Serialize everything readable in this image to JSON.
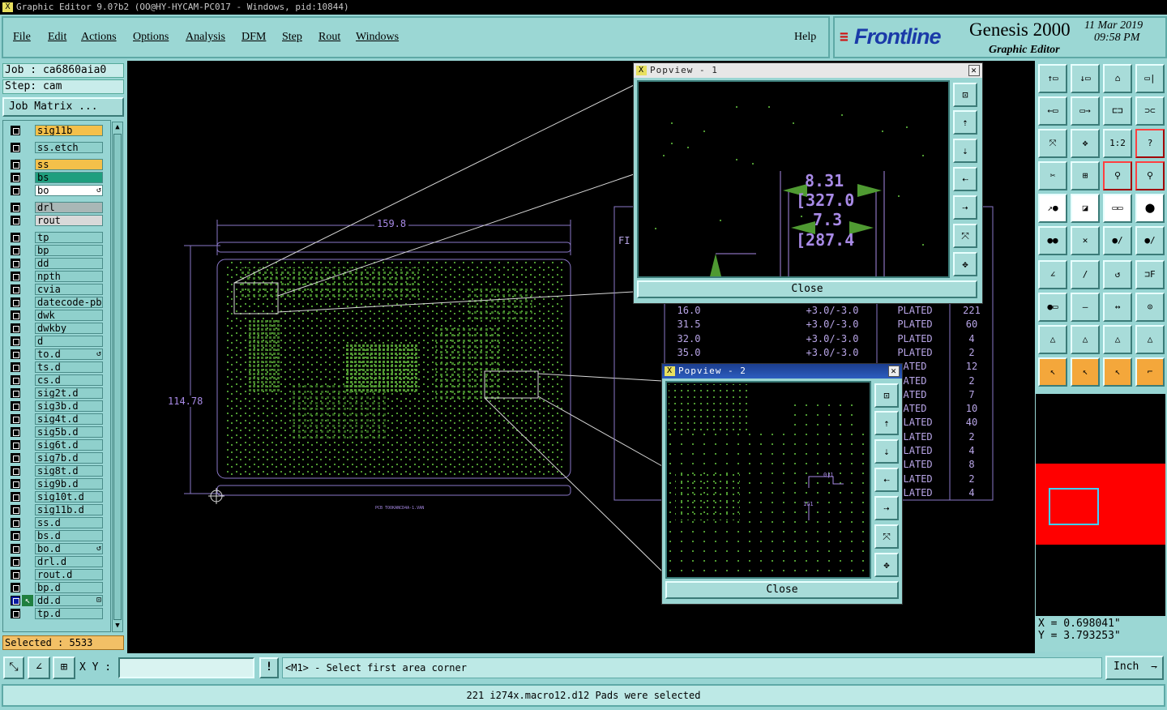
{
  "window": {
    "title": "Graphic Editor 9.0?b2 (OO@HY-HYCAM-PC017 - Windows, pid:10844)",
    "title_icon": "x-icon"
  },
  "menu": {
    "file": "File",
    "edit": "Edit",
    "actions": "Actions",
    "options": "Options",
    "analysis": "Analysis",
    "dfm": "DFM",
    "step": "Step",
    "rout": "Rout",
    "windows": "Windows",
    "help": "Help"
  },
  "brand": {
    "logo": "Frontline",
    "product": "Genesis 2000",
    "subtitle": "Graphic Editor",
    "date": "11 Mar 2019",
    "time": "09:58 PM"
  },
  "job": {
    "job_label": "Job : ca6860aia0",
    "step_label": "Step: cam",
    "matrix_button": "Job Matrix ..."
  },
  "layers": [
    {
      "name": "sig11b",
      "color": "#f4c04a"
    },
    {
      "name": "ss.etch",
      "color": "#8fd0cc"
    },
    {
      "name": "ss",
      "color": "#f4c04a"
    },
    {
      "name": "bs",
      "color": "#1f9e7e"
    },
    {
      "name": "bo",
      "color": "#ffffff",
      "marker": "↺"
    },
    {
      "name": "drl",
      "color": "#a9b7b6"
    },
    {
      "name": "rout",
      "color": "#d9d9d9"
    },
    {
      "name": "tp",
      "color": "#8fd0cc"
    },
    {
      "name": "bp",
      "color": "#8fd0cc"
    },
    {
      "name": "dd",
      "color": "#8fd0cc"
    },
    {
      "name": "npth",
      "color": "#8fd0cc"
    },
    {
      "name": "cvia",
      "color": "#8fd0cc"
    },
    {
      "name": "datecode-pbe",
      "color": "#8fd0cc"
    },
    {
      "name": "dwk",
      "color": "#8fd0cc"
    },
    {
      "name": "dwkby",
      "color": "#8fd0cc"
    },
    {
      "name": "d",
      "color": "#8fd0cc"
    },
    {
      "name": "to.d",
      "color": "#8fd0cc",
      "marker": "↺"
    },
    {
      "name": "ts.d",
      "color": "#8fd0cc"
    },
    {
      "name": "cs.d",
      "color": "#8fd0cc"
    },
    {
      "name": "sig2t.d",
      "color": "#8fd0cc"
    },
    {
      "name": "sig3b.d",
      "color": "#8fd0cc"
    },
    {
      "name": "sig4t.d",
      "color": "#8fd0cc"
    },
    {
      "name": "sig5b.d",
      "color": "#8fd0cc"
    },
    {
      "name": "sig6t.d",
      "color": "#8fd0cc"
    },
    {
      "name": "sig7b.d",
      "color": "#8fd0cc"
    },
    {
      "name": "sig8t.d",
      "color": "#8fd0cc"
    },
    {
      "name": "sig9b.d",
      "color": "#8fd0cc"
    },
    {
      "name": "sig10t.d",
      "color": "#8fd0cc"
    },
    {
      "name": "sig11b.d",
      "color": "#8fd0cc"
    },
    {
      "name": "ss.d",
      "color": "#8fd0cc"
    },
    {
      "name": "bs.d",
      "color": "#8fd0cc"
    },
    {
      "name": "bo.d",
      "color": "#8fd0cc",
      "marker": "↺"
    },
    {
      "name": "drl.d",
      "color": "#8fd0cc"
    },
    {
      "name": "rout.d",
      "color": "#8fd0cc"
    },
    {
      "name": "bp.d",
      "color": "#8fd0cc"
    },
    {
      "name": "dd.d",
      "color": "#8fd0cc",
      "marker": "⊡"
    },
    {
      "name": "tp.d",
      "color": "#8fd0cc"
    }
  ],
  "selected": "Selected : 5533",
  "canvas": {
    "dim_width": "159.8",
    "dim_height": "114.78",
    "tiny_label": "PCB TOOKANCD4A-1.VAN",
    "drill_table": [
      {
        "size": "16.0",
        "tol": "+3.0/-3.0",
        "type": "PLATED",
        "count": "221"
      },
      {
        "size": "31.5",
        "tol": "+3.0/-3.0",
        "type": "PLATED",
        "count": "60"
      },
      {
        "size": "32.0",
        "tol": "+3.0/-3.0",
        "type": "PLATED",
        "count": "4"
      },
      {
        "size": "35.0",
        "tol": "+3.0/-3.0",
        "type": "PLATED",
        "count": "2"
      },
      {
        "size": "",
        "tol": "",
        "type": "ATED",
        "count": "12"
      },
      {
        "size": "",
        "tol": "",
        "type": "ATED",
        "count": "2"
      },
      {
        "size": "",
        "tol": "",
        "type": "ATED",
        "count": "7"
      },
      {
        "size": "",
        "tol": "",
        "type": "ATED",
        "count": "10"
      },
      {
        "size": "",
        "tol": "",
        "type": "PLATED",
        "count": "40"
      },
      {
        "size": "",
        "tol": "",
        "type": "PLATED",
        "count": "2"
      },
      {
        "size": "",
        "tol": "",
        "type": "PLATED",
        "count": "4"
      },
      {
        "size": "",
        "tol": "",
        "type": "PLATED",
        "count": "8"
      },
      {
        "size": "",
        "tol": "",
        "type": "PLATED",
        "count": "2"
      },
      {
        "size": "",
        "tol": "",
        "type": "PLATED",
        "count": "4"
      }
    ],
    "table_header_fragment": "FI"
  },
  "popview1": {
    "title": "Popview - 1",
    "close": "Close",
    "dims": [
      "8.31",
      "[327.0",
      "7.3",
      "[287.4"
    ]
  },
  "popview2": {
    "title": "Popview - 2",
    "close": "Close",
    "tiny": "0|1",
    "tiny2": "1G1"
  },
  "toolbar_right": [
    "↑▭",
    "↓▭",
    "⌂",
    "▭|",
    "←▭",
    "▭→",
    "⊏⊐",
    "⊃⊂",
    "⤧",
    "✥",
    "1:2",
    "?",
    "✂",
    "⊞",
    "⚲",
    "⚲",
    "↗●",
    "◪",
    "▭▭",
    "⬤",
    "●●",
    "✕",
    "●/",
    "●/",
    "∠",
    "/",
    "↺",
    "⊐F",
    "●▭",
    "—",
    "↔",
    "⊙",
    "△",
    "△",
    "△",
    "△",
    "↖",
    "↖",
    "↖",
    "⌐"
  ],
  "coords": {
    "x": "X = 0.698041\"",
    "y": "Y = 3.793253\""
  },
  "status": {
    "xy_label": "X Y :",
    "xy_value": "",
    "prompt": "<M1> - Select first area corner",
    "units": "Inch",
    "units_arrow": "⇁",
    "message": "221 i274x.macro12.d12 Pads were selected",
    "warn": "!"
  },
  "colors": {
    "panel": "#97d5d3",
    "canvas": "#000000",
    "copper": "#4f9a32",
    "dim": "#a88ae6"
  }
}
